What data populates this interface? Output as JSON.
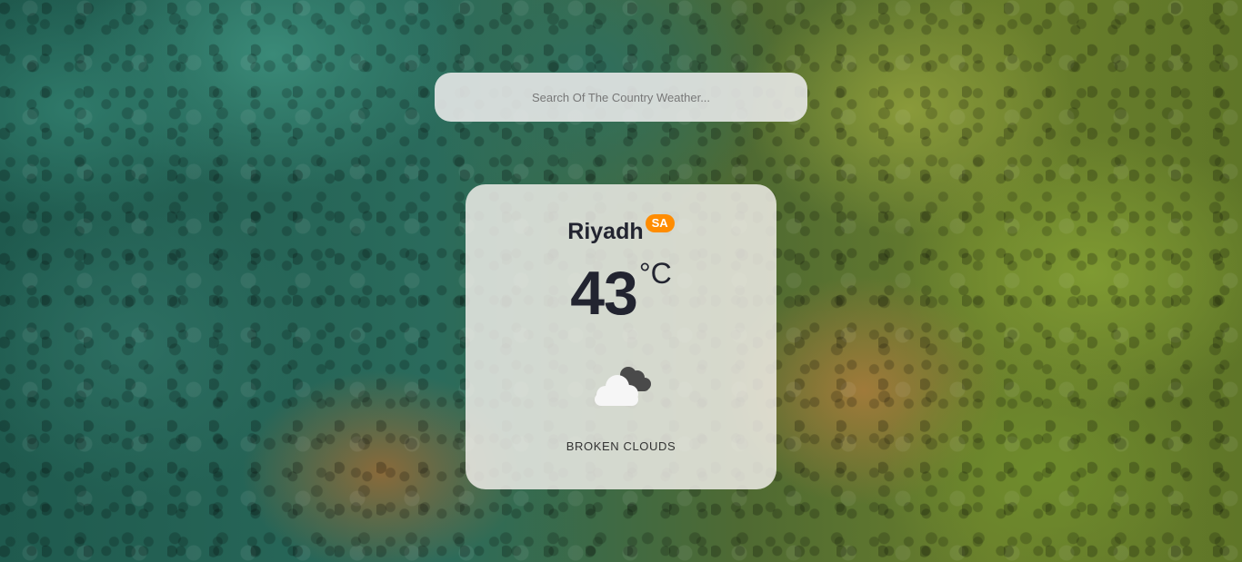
{
  "search": {
    "placeholder": "Search Of The Country Weather...",
    "value": ""
  },
  "weather": {
    "city": "Riyadh",
    "country_code": "SA",
    "temperature": "43",
    "unit": "°C",
    "icon": "broken-clouds-icon",
    "description": "BROKEN CLOUDS"
  },
  "colors": {
    "badge": "#ff8c00",
    "text": "#222430"
  }
}
